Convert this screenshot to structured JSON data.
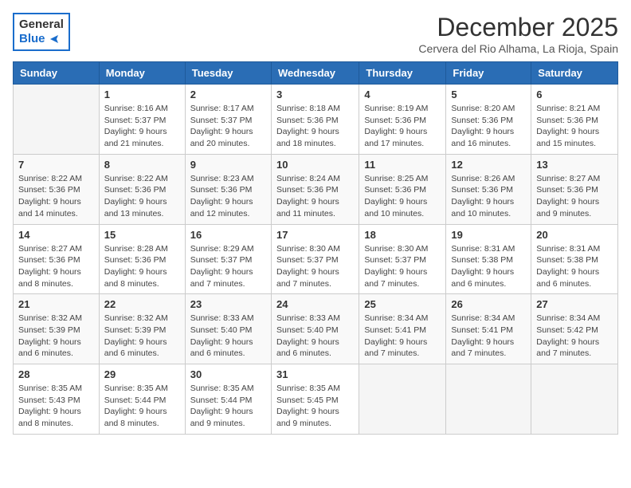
{
  "logo": {
    "line1": "General",
    "line2": "Blue"
  },
  "title": "December 2025",
  "location": "Cervera del Rio Alhama, La Rioja, Spain",
  "days_of_week": [
    "Sunday",
    "Monday",
    "Tuesday",
    "Wednesday",
    "Thursday",
    "Friday",
    "Saturday"
  ],
  "weeks": [
    [
      {
        "day": "",
        "info": ""
      },
      {
        "day": "1",
        "info": "Sunrise: 8:16 AM\nSunset: 5:37 PM\nDaylight: 9 hours\nand 21 minutes."
      },
      {
        "day": "2",
        "info": "Sunrise: 8:17 AM\nSunset: 5:37 PM\nDaylight: 9 hours\nand 20 minutes."
      },
      {
        "day": "3",
        "info": "Sunrise: 8:18 AM\nSunset: 5:36 PM\nDaylight: 9 hours\nand 18 minutes."
      },
      {
        "day": "4",
        "info": "Sunrise: 8:19 AM\nSunset: 5:36 PM\nDaylight: 9 hours\nand 17 minutes."
      },
      {
        "day": "5",
        "info": "Sunrise: 8:20 AM\nSunset: 5:36 PM\nDaylight: 9 hours\nand 16 minutes."
      },
      {
        "day": "6",
        "info": "Sunrise: 8:21 AM\nSunset: 5:36 PM\nDaylight: 9 hours\nand 15 minutes."
      }
    ],
    [
      {
        "day": "7",
        "info": "Sunrise: 8:22 AM\nSunset: 5:36 PM\nDaylight: 9 hours\nand 14 minutes."
      },
      {
        "day": "8",
        "info": "Sunrise: 8:22 AM\nSunset: 5:36 PM\nDaylight: 9 hours\nand 13 minutes."
      },
      {
        "day": "9",
        "info": "Sunrise: 8:23 AM\nSunset: 5:36 PM\nDaylight: 9 hours\nand 12 minutes."
      },
      {
        "day": "10",
        "info": "Sunrise: 8:24 AM\nSunset: 5:36 PM\nDaylight: 9 hours\nand 11 minutes."
      },
      {
        "day": "11",
        "info": "Sunrise: 8:25 AM\nSunset: 5:36 PM\nDaylight: 9 hours\nand 10 minutes."
      },
      {
        "day": "12",
        "info": "Sunrise: 8:26 AM\nSunset: 5:36 PM\nDaylight: 9 hours\nand 10 minutes."
      },
      {
        "day": "13",
        "info": "Sunrise: 8:27 AM\nSunset: 5:36 PM\nDaylight: 9 hours\nand 9 minutes."
      }
    ],
    [
      {
        "day": "14",
        "info": "Sunrise: 8:27 AM\nSunset: 5:36 PM\nDaylight: 9 hours\nand 8 minutes."
      },
      {
        "day": "15",
        "info": "Sunrise: 8:28 AM\nSunset: 5:36 PM\nDaylight: 9 hours\nand 8 minutes."
      },
      {
        "day": "16",
        "info": "Sunrise: 8:29 AM\nSunset: 5:37 PM\nDaylight: 9 hours\nand 7 minutes."
      },
      {
        "day": "17",
        "info": "Sunrise: 8:30 AM\nSunset: 5:37 PM\nDaylight: 9 hours\nand 7 minutes."
      },
      {
        "day": "18",
        "info": "Sunrise: 8:30 AM\nSunset: 5:37 PM\nDaylight: 9 hours\nand 7 minutes."
      },
      {
        "day": "19",
        "info": "Sunrise: 8:31 AM\nSunset: 5:38 PM\nDaylight: 9 hours\nand 6 minutes."
      },
      {
        "day": "20",
        "info": "Sunrise: 8:31 AM\nSunset: 5:38 PM\nDaylight: 9 hours\nand 6 minutes."
      }
    ],
    [
      {
        "day": "21",
        "info": "Sunrise: 8:32 AM\nSunset: 5:39 PM\nDaylight: 9 hours\nand 6 minutes."
      },
      {
        "day": "22",
        "info": "Sunrise: 8:32 AM\nSunset: 5:39 PM\nDaylight: 9 hours\nand 6 minutes."
      },
      {
        "day": "23",
        "info": "Sunrise: 8:33 AM\nSunset: 5:40 PM\nDaylight: 9 hours\nand 6 minutes."
      },
      {
        "day": "24",
        "info": "Sunrise: 8:33 AM\nSunset: 5:40 PM\nDaylight: 9 hours\nand 6 minutes."
      },
      {
        "day": "25",
        "info": "Sunrise: 8:34 AM\nSunset: 5:41 PM\nDaylight: 9 hours\nand 7 minutes."
      },
      {
        "day": "26",
        "info": "Sunrise: 8:34 AM\nSunset: 5:41 PM\nDaylight: 9 hours\nand 7 minutes."
      },
      {
        "day": "27",
        "info": "Sunrise: 8:34 AM\nSunset: 5:42 PM\nDaylight: 9 hours\nand 7 minutes."
      }
    ],
    [
      {
        "day": "28",
        "info": "Sunrise: 8:35 AM\nSunset: 5:43 PM\nDaylight: 9 hours\nand 8 minutes."
      },
      {
        "day": "29",
        "info": "Sunrise: 8:35 AM\nSunset: 5:44 PM\nDaylight: 9 hours\nand 8 minutes."
      },
      {
        "day": "30",
        "info": "Sunrise: 8:35 AM\nSunset: 5:44 PM\nDaylight: 9 hours\nand 9 minutes."
      },
      {
        "day": "31",
        "info": "Sunrise: 8:35 AM\nSunset: 5:45 PM\nDaylight: 9 hours\nand 9 minutes."
      },
      {
        "day": "",
        "info": ""
      },
      {
        "day": "",
        "info": ""
      },
      {
        "day": "",
        "info": ""
      }
    ]
  ]
}
